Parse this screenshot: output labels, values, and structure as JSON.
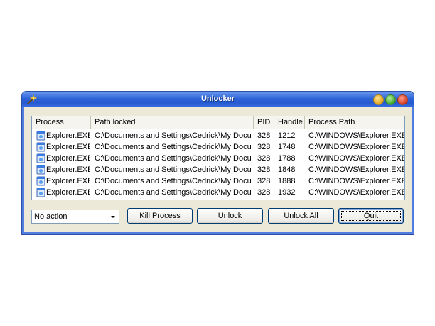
{
  "window": {
    "title": "Unlocker"
  },
  "list": {
    "columns": [
      "Process",
      "Path locked",
      "PID",
      "Handle",
      "Process Path"
    ],
    "rows": [
      {
        "process": "Explorer.EXE",
        "path": "C:\\Documents and Settings\\Cedrick\\My Docu...",
        "pid": "328",
        "handle": "1212",
        "process_path": "C:\\WINDOWS\\Explorer.EXE"
      },
      {
        "process": "Explorer.EXE",
        "path": "C:\\Documents and Settings\\Cedrick\\My Docu...",
        "pid": "328",
        "handle": "1748",
        "process_path": "C:\\WINDOWS\\Explorer.EXE"
      },
      {
        "process": "Explorer.EXE",
        "path": "C:\\Documents and Settings\\Cedrick\\My Docu...",
        "pid": "328",
        "handle": "1788",
        "process_path": "C:\\WINDOWS\\Explorer.EXE"
      },
      {
        "process": "Explorer.EXE",
        "path": "C:\\Documents and Settings\\Cedrick\\My Docu...",
        "pid": "328",
        "handle": "1848",
        "process_path": "C:\\WINDOWS\\Explorer.EXE"
      },
      {
        "process": "Explorer.EXE",
        "path": "C:\\Documents and Settings\\Cedrick\\My Docu...",
        "pid": "328",
        "handle": "1888",
        "process_path": "C:\\WINDOWS\\Explorer.EXE"
      },
      {
        "process": "Explorer.EXE",
        "path": "C:\\Documents and Settings\\Cedrick\\My Docu...",
        "pid": "328",
        "handle": "1932",
        "process_path": "C:\\WINDOWS\\Explorer.EXE"
      }
    ],
    "row_icon": "process-window-icon"
  },
  "action": {
    "selected": "No action"
  },
  "buttons": {
    "kill_process": "Kill Process",
    "unlock": "Unlock",
    "unlock_all": "Unlock All",
    "quit": "Quit"
  },
  "colors": {
    "titlebar": "#2358d0",
    "face": "#ece9d8",
    "minimize": "#e0a320",
    "maximize": "#3ca52a",
    "close": "#d23c22"
  }
}
